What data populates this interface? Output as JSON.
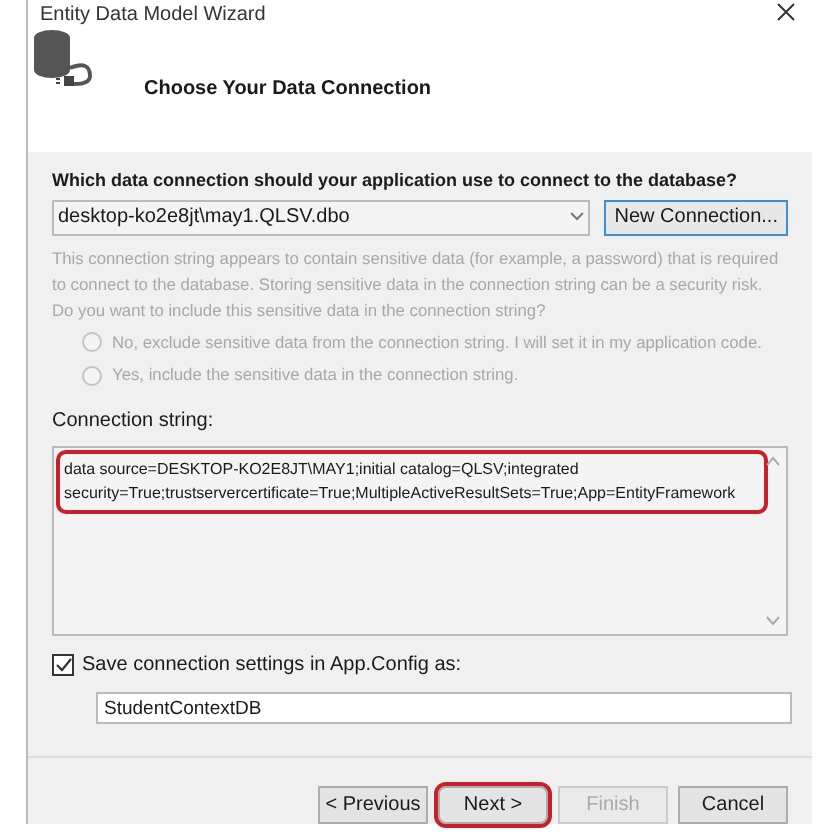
{
  "window": {
    "title": "Entity Data Model Wizard"
  },
  "header": {
    "title": "Choose Your Data Connection"
  },
  "question": "Which data connection should your application use to connect to the database?",
  "connection": {
    "value": "desktop-ko2e8jt\\may1.QLSV.dbo"
  },
  "new_connection_button": "New Connection...",
  "sensitive_notice": {
    "text": "This connection string appears to contain sensitive data (for example, a password) that is required to connect to the database. Storing sensitive data in the connection string can be a security risk. Do you want to include this sensitive data in the connection string?",
    "disabled": true
  },
  "sensitive_options": [
    {
      "label": "No, exclude sensitive data from the connection string. I will set it in my application code.",
      "selected": false,
      "disabled": true
    },
    {
      "label": "Yes, include the sensitive data in the connection string.",
      "selected": false,
      "disabled": true
    }
  ],
  "connection_string": {
    "label": "Connection string:",
    "value": "data source=DESKTOP-KO2E8JT\\MAY1;initial catalog=QLSV;integrated security=True;trustservercertificate=True;MultipleActiveResultSets=True;App=EntityFramework",
    "highlighted": true
  },
  "save_settings": {
    "label": "Save connection settings in App.Config as:",
    "checked": true,
    "value": "StudentContextDB"
  },
  "buttons": [
    {
      "label": "< Previous",
      "disabled": false,
      "highlighted": false
    },
    {
      "label": "Next >",
      "disabled": false,
      "highlighted": true
    },
    {
      "label": "Finish",
      "disabled": true,
      "highlighted": false
    },
    {
      "label": "Cancel",
      "disabled": false,
      "highlighted": false
    }
  ]
}
